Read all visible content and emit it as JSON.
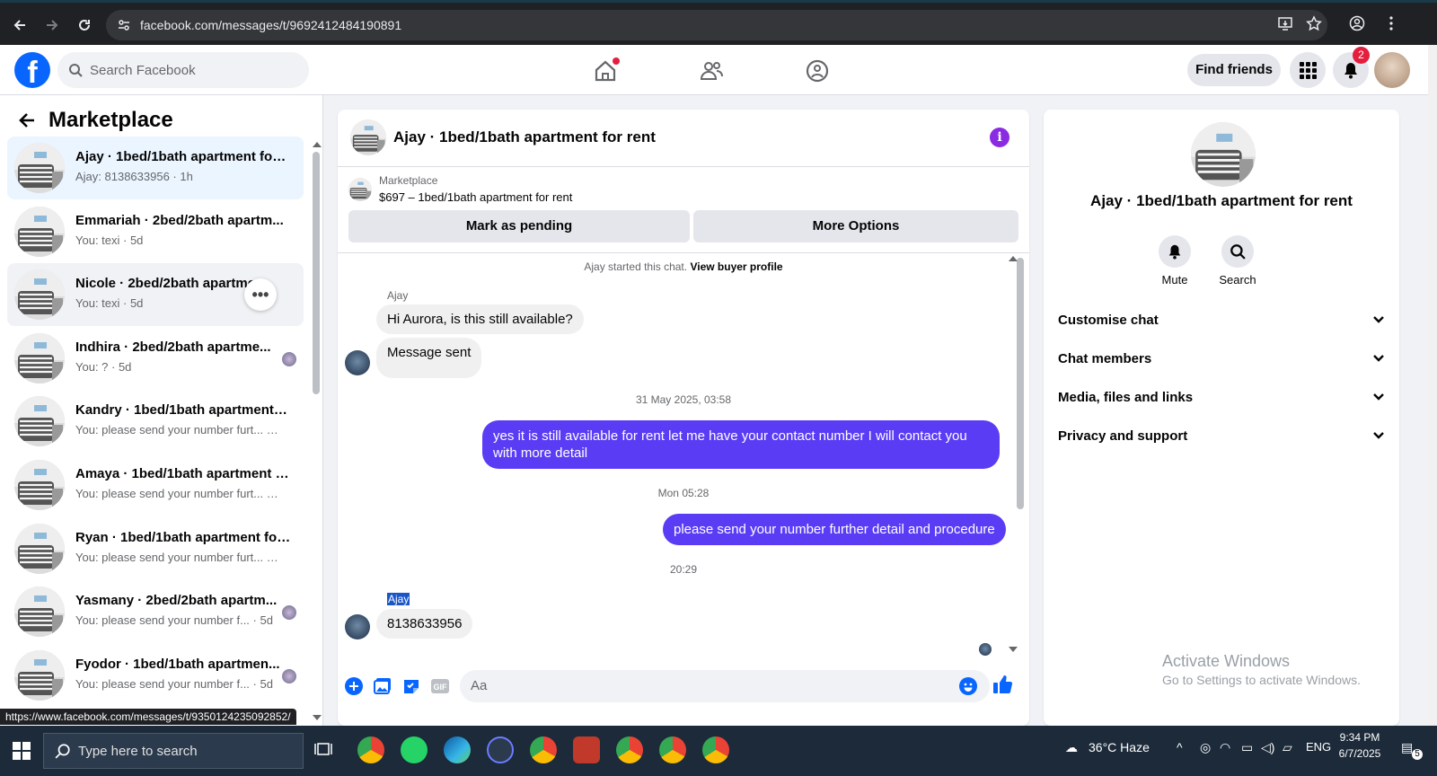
{
  "browser": {
    "url": "facebook.com/messages/t/9692412484190891",
    "status_url": "https://www.facebook.com/messages/t/9350124235092852/"
  },
  "header": {
    "search_placeholder": "Search Facebook",
    "find_friends": "Find friends",
    "notification_count": "2"
  },
  "sidebar": {
    "title": "Marketplace",
    "conversations": [
      {
        "title": "Ajay · 1bed/1bath apartment for ...",
        "snippet": "Ajay: 8138633956 · 1h"
      },
      {
        "title": "Emmariah · 2bed/2bath apartm...",
        "snippet": "You: texi · 5d"
      },
      {
        "title": "Nicole · 2bed/2bath apartme",
        "snippet": "You: texi · 5d"
      },
      {
        "title": "Indhira · 2bed/2bath apartme...",
        "snippet": "You: ? · 5d"
      },
      {
        "title": "Kandry · 1bed/1bath apartment f...",
        "snippet": "You: please send your number furt... · 5d"
      },
      {
        "title": "Amaya · 1bed/1bath apartment f...",
        "snippet": "You: please send your number furt... · 5d"
      },
      {
        "title": "Ryan · 1bed/1bath apartment for...",
        "snippet": "You: please send your number furt... · 5d"
      },
      {
        "title": "Yasmany · 2bed/2bath apartm...",
        "snippet": "You: please send your number f... · 5d"
      },
      {
        "title": "Fyodor · 1bed/1bath apartmen...",
        "snippet": "You: please send your number f... · 5d"
      }
    ]
  },
  "chat": {
    "title": "Ajay · 1bed/1bath apartment for rent",
    "listing_label": "Marketplace",
    "listing_price": "$697 – 1bed/1bath apartment for rent",
    "mark_pending": "Mark as pending",
    "more_options": "More Options",
    "started_text": "Ajay started this chat.",
    "view_buyer": "View buyer profile",
    "sender1": "Ajay",
    "msg1": "Hi Aurora, is this still available?",
    "msg2": "Message sent",
    "time1": "31 May 2025, 03:58",
    "msg3": "yes it is still available for rent let me have your contact number I will contact you with more detail",
    "time2": "Mon 05:28",
    "msg4": "please send your number further detail and procedure",
    "time3": "20:29",
    "sender2": "Ajay",
    "msg5": "8138633956",
    "input_placeholder": "Aa"
  },
  "details": {
    "title": "Ajay · 1bed/1bath apartment for rent",
    "mute": "Mute",
    "search": "Search",
    "sections": [
      "Customise chat",
      "Chat members",
      "Media, files and links",
      "Privacy and support"
    ]
  },
  "watermark": {
    "line1": "Activate Windows",
    "line2": "Go to Settings to activate Windows."
  },
  "taskbar": {
    "search_placeholder": "Type here to search",
    "weather": "36°C  Haze",
    "lang": "ENG",
    "time": "9:34 PM",
    "date": "6/7/2025",
    "notif_count": "5"
  },
  "colors": {
    "accent": "#0866ff",
    "outgoing_bubble": "#5b3cf5",
    "info": "#8a2be2"
  }
}
